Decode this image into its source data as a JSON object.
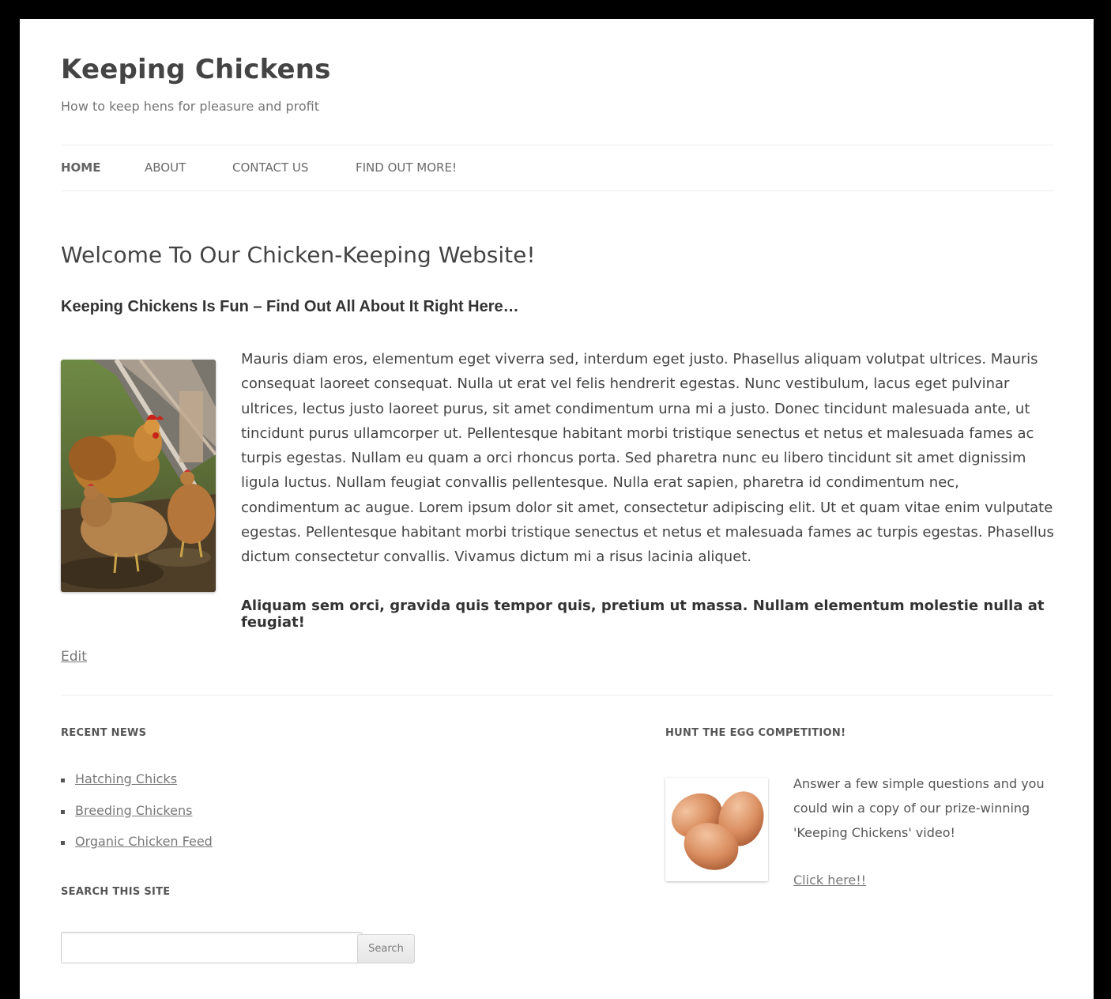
{
  "site": {
    "title": "Keeping Chickens",
    "description": "How to keep hens for pleasure and profit"
  },
  "nav": {
    "items": [
      {
        "label": "HOME",
        "active": true
      },
      {
        "label": "ABOUT",
        "active": false
      },
      {
        "label": "CONTACT US",
        "active": false
      },
      {
        "label": "FIND OUT MORE!",
        "active": false
      }
    ]
  },
  "entry": {
    "title": "Welcome To Our Chicken-Keeping Website!",
    "subtitle": "Keeping Chickens Is Fun – Find Out All About It Right Here…",
    "body": "Mauris diam eros, elementum eget viverra sed, interdum eget justo. Phasellus aliquam volutpat ultrices. Mauris consequat laoreet consequat. Nulla ut erat vel felis hendrerit egestas. Nunc vestibulum, lacus eget pulvinar ultrices, lectus justo laoreet purus, sit amet condimentum urna mi a justo. Donec tincidunt malesuada ante, ut tincidunt purus ullamcorper ut. Pellentesque habitant morbi tristique senectus et netus et malesuada fames ac turpis egestas. Nullam eu quam a orci rhoncus porta. Sed pharetra nunc eu libero tincidunt sit amet dignissim ligula luctus. Nullam feugiat convallis pellentesque. Nulla erat sapien, pharetra id condimentum nec, condimentum ac augue. Lorem ipsum dolor sit amet, consectetur adipiscing elit. Ut et quam vitae enim vulputate egestas. Pellentesque habitant morbi tristique senectus et netus et malesuada fames ac turpis egestas. Phasellus dictum consectetur convallis. Vivamus dictum mi a risus lacinia aliquet.",
    "bold_line": "Aliquam sem orci, gravida quis tempor quis, pretium ut massa. Nullam elementum molestie nulla at feugiat!",
    "edit_label": "Edit"
  },
  "recent_news": {
    "title": "RECENT NEWS",
    "items": [
      "Hatching Chicks",
      "Breeding Chickens",
      "Organic Chicken Feed"
    ]
  },
  "search": {
    "title": "SEARCH THIS SITE",
    "value": "",
    "button_label": "Search"
  },
  "competition": {
    "title": "HUNT THE EGG COMPETITION!",
    "text": "Answer a few simple questions and you could win a copy of our prize-winning 'Keeping Chickens' video!",
    "link_label": "Click here!!"
  }
}
